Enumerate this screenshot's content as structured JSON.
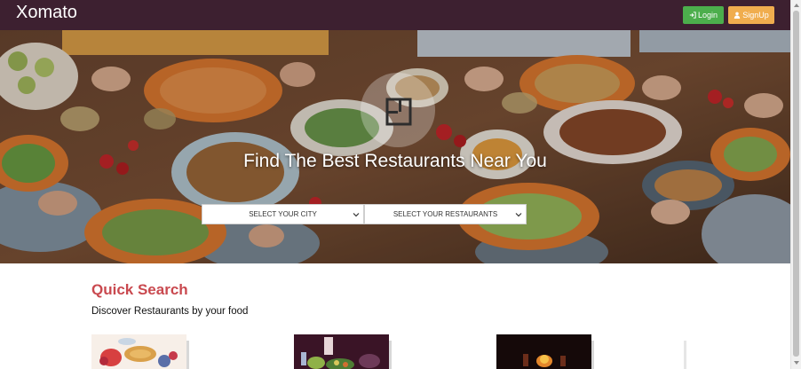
{
  "header": {
    "brand": "Xomato",
    "login_label": "Login",
    "signup_label": "SignUp",
    "login_icon": "login-icon",
    "signup_icon": "user-icon",
    "colors": {
      "bar": "#3d2030",
      "login": "#4cae4c",
      "signup": "#f0ad4e"
    }
  },
  "hero": {
    "title": "Find The Best Restaurants Near You",
    "city_select": {
      "selected": "SELECT YOUR CITY"
    },
    "restaurant_select": {
      "selected": "SELECT YOUR RESTAURANTS"
    },
    "logo_icon": "xomato-logo-icon"
  },
  "quick_search": {
    "title": "Quick Search",
    "subtitle": "Discover Restaurants by your food",
    "title_color": "#c9494f",
    "cards": [
      {
        "icon": "breakfast-food-image"
      },
      {
        "icon": "drinks-food-image"
      },
      {
        "icon": "dinner-food-image"
      }
    ]
  }
}
